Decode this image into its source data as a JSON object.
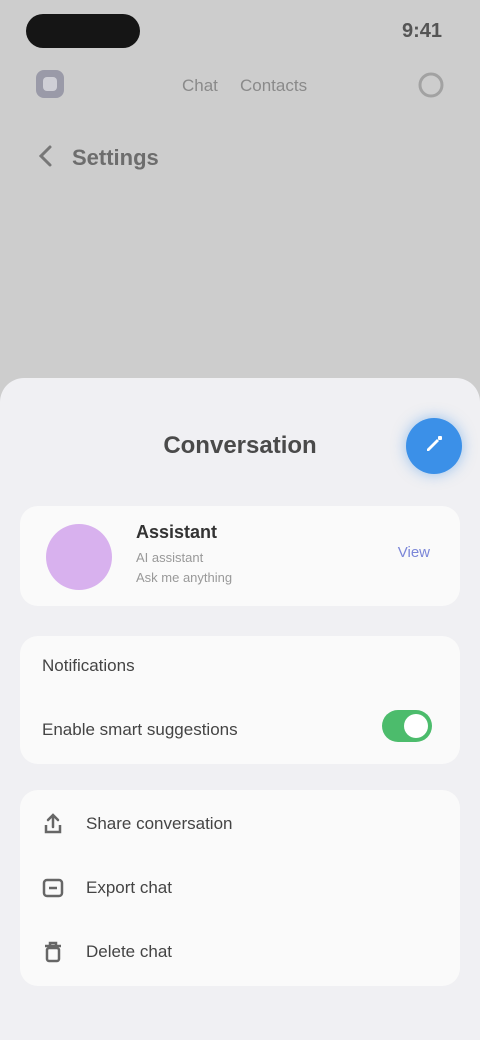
{
  "status": {
    "time": "9:41"
  },
  "background": {
    "tabs": [
      "Chat",
      "Contacts"
    ],
    "back_title": "Settings"
  },
  "sheet": {
    "title": "Conversation"
  },
  "profile": {
    "name": "Assistant",
    "subtitle_1": "AI assistant",
    "subtitle_2": "Ask me anything",
    "action_label": "View"
  },
  "settings": {
    "row1_label": "Notifications",
    "row2_label": "Enable smart suggestions",
    "toggle_on": true
  },
  "menu": {
    "items": [
      {
        "label": "Share conversation",
        "icon": "share-icon"
      },
      {
        "label": "Export chat",
        "icon": "export-icon"
      },
      {
        "label": "Delete chat",
        "icon": "trash-icon"
      }
    ]
  },
  "colors": {
    "accent": "#3b90e8",
    "toggle": "#4cbc6c",
    "avatar": "#d8b1ee",
    "link": "#7b86d8"
  }
}
